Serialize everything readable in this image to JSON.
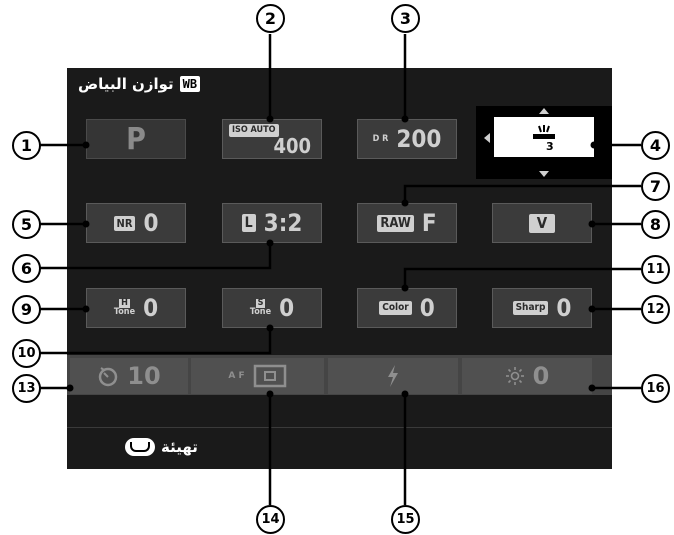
{
  "header": {
    "title": "توازن البياض",
    "badge": "WB"
  },
  "tiles": {
    "mode": {
      "label": "P"
    },
    "iso": {
      "icon": "ISO AUTO",
      "value": "400"
    },
    "dr": {
      "icon": "D R",
      "value": "200"
    },
    "wb_icon": "fluorescent-3-icon",
    "nr": {
      "icon": "NR",
      "value": "0"
    },
    "size": {
      "icon": "L",
      "value": "3:2"
    },
    "raw": {
      "icon": "RAW",
      "value": "F"
    },
    "film": {
      "icon": "V"
    },
    "htone": {
      "icon_top": "H",
      "icon_bottom": "Tone",
      "value": "0"
    },
    "stone": {
      "icon_top": "S",
      "icon_bottom": "Tone",
      "value": "0"
    },
    "color": {
      "icon": "Color",
      "value": "0"
    },
    "sharp": {
      "icon": "Sharp",
      "value": "0"
    },
    "timer": {
      "value": "10"
    },
    "af": {
      "icon": "A F"
    },
    "flash": {
      "icon": "flash-icon"
    },
    "brightness": {
      "value": "0"
    }
  },
  "footer": {
    "label": "تهيئة"
  },
  "callouts": [
    "1",
    "2",
    "3",
    "4",
    "5",
    "6",
    "7",
    "8",
    "9",
    "10",
    "11",
    "12",
    "13",
    "14",
    "15",
    "16"
  ]
}
